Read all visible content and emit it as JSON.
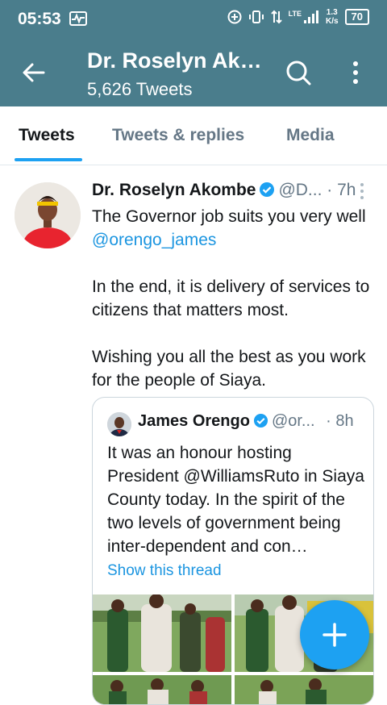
{
  "status_bar": {
    "time": "05:53",
    "network": "LTE",
    "speed_value": "1.3",
    "speed_unit": "K/s",
    "battery": "70",
    "icons": [
      "activity-icon",
      "add-circle-icon",
      "vibrate-icon",
      "data-transfer-icon",
      "signal-icon",
      "battery-icon"
    ]
  },
  "header": {
    "title": "Dr. Roselyn Akombe",
    "tweet_count": "5,626 Tweets"
  },
  "tabs": [
    {
      "label": "Tweets",
      "active": true
    },
    {
      "label": "Tweets & replies",
      "active": false
    },
    {
      "label": "Media",
      "active": false
    }
  ],
  "tweet": {
    "name": "Dr. Roselyn Akombe",
    "handle": "@D...",
    "time": "· 7h",
    "verified": true,
    "line1": "The Governor job suits you very well",
    "mention": "@orengo_james",
    "para2": "In the end, it is delivery of services to citizens that matters most.",
    "para3": "Wishing you all the best as you work for the people of Siaya.",
    "quoted": {
      "name": "James Orengo",
      "handle": "@or...",
      "time": "· 8h",
      "verified": true,
      "text": "It was an honour hosting President @WilliamsRuto in Siaya County today. In the spirit of the two levels of government being inter-dependent and con…",
      "show_thread": "Show this thread"
    }
  },
  "colors": {
    "header_bg": "#4a7d8c",
    "accent": "#1da1f2",
    "link": "#1b95e0",
    "secondary_text": "#657786"
  }
}
